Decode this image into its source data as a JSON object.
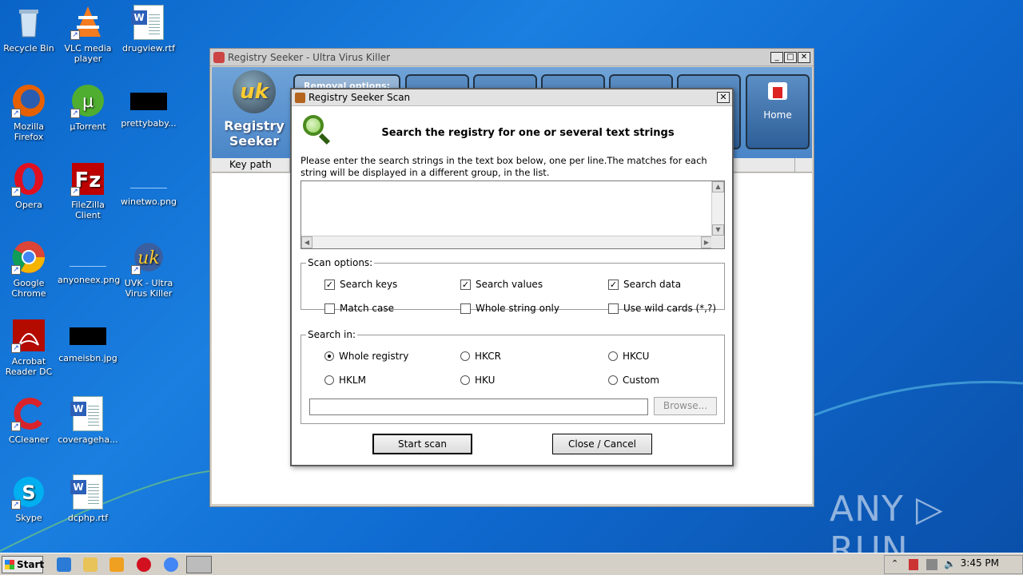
{
  "desktop": {
    "icons": [
      {
        "label": "Recycle Bin"
      },
      {
        "label": "VLC media player"
      },
      {
        "label": "drugview.rtf"
      },
      {
        "label": "Mozilla Firefox"
      },
      {
        "label": "µTorrent"
      },
      {
        "label": "prettybaby..."
      },
      {
        "label": "Opera"
      },
      {
        "label": "FileZilla Client"
      },
      {
        "label": "winetwo.png"
      },
      {
        "label": "Google Chrome"
      },
      {
        "label": "anyoneex.png"
      },
      {
        "label": "UVK - Ultra Virus Killer"
      },
      {
        "label": "Acrobat Reader DC"
      },
      {
        "label": "cameisbn.jpg"
      },
      {
        "label": "CCleaner"
      },
      {
        "label": "coverageha..."
      },
      {
        "label": "Skype"
      },
      {
        "label": "dcphp.rtf"
      }
    ],
    "watermark": "ANY ▷ RUN"
  },
  "main_window": {
    "title": "Registry Seeker - Ultra Virus Killer",
    "logo_text": "Registry Seeker",
    "removal_label": "Removal options:",
    "home_label": "Home",
    "column_key_path": "Key path",
    "window_buttons": {
      "minimize": "_",
      "maximize": "□",
      "close": "✕"
    }
  },
  "dialog": {
    "title": "Registry Seeker Scan",
    "close": "✕",
    "headline": "Search the registry for one or several text strings",
    "instructions": "Please enter the search strings in the text box below, one per line.The matches for each string will be displayed in a different group, in the list.",
    "search_text": "",
    "scan_options": {
      "legend": "Scan options:",
      "search_keys": {
        "label": "Search keys",
        "checked": true
      },
      "search_values": {
        "label": "Search values",
        "checked": true
      },
      "search_data": {
        "label": "Search data",
        "checked": true
      },
      "match_case": {
        "label": "Match case",
        "checked": false
      },
      "whole_string": {
        "label": "Whole string only",
        "checked": false
      },
      "wild_cards": {
        "label": "Use wild cards (*,?)",
        "checked": false
      }
    },
    "search_in": {
      "legend": "Search in:",
      "selected": "Whole registry",
      "whole_registry": "Whole registry",
      "hkcr": "HKCR",
      "hkcu": "HKCU",
      "hklm": "HKLM",
      "hku": "HKU",
      "custom": "Custom",
      "custom_path": "",
      "browse": "Browse..."
    },
    "start_scan": "Start scan",
    "close_cancel": "Close / Cancel"
  },
  "taskbar": {
    "start": "Start",
    "clock": "3:45 PM"
  }
}
